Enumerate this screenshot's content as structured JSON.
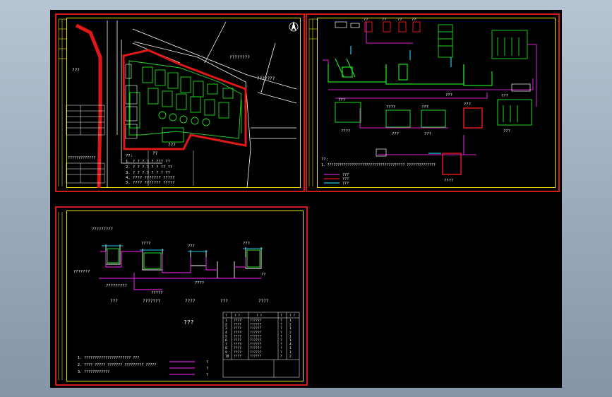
{
  "sheets": [
    {
      "id": "site-plan",
      "title": "???",
      "labels": {
        "boundary_top": "????????",
        "boundary_right": "???????",
        "building_left": "???",
        "entrance": "???",
        "gate": "??"
      },
      "notes": [
        "??:",
        "1. ? ? ? ? ? ???  ??",
        "2. ? ? ? ? ? ? ?? ??",
        "3. ? ? ? ? ? ? ? ??",
        "4. ???? ??????? ?????",
        "5. ???? ??????? ?????",
        "6. ????? ??????? ?????"
      ],
      "legend_title": "?????????????"
    },
    {
      "id": "process-flow",
      "title": "???",
      "tags": [
        "??",
        "??",
        "??",
        "??",
        "???",
        "???",
        "????",
        "???",
        "???",
        "???",
        "????",
        "???",
        "???",
        "???",
        "????"
      ],
      "notes": [
        "??:",
        "1. ?????????????????????????????????????? ??????????????"
      ],
      "legend": [
        "???",
        "???",
        "???"
      ]
    },
    {
      "id": "elevation",
      "title": "???",
      "tags": [
        "?????????",
        "????",
        "???",
        "???",
        "???????",
        "?????????",
        "?????",
        "????",
        "??"
      ],
      "captions": [
        "???",
        "???????",
        "????",
        "???",
        "????"
      ],
      "center_title": "???",
      "notes": [
        "1. ?????????????????????? ???",
        "2. ???? ????? ??????? ????????? ?????",
        "3. ????????????"
      ],
      "legend": [
        "?",
        "?",
        "?"
      ],
      "table_header": [
        "?",
        "? ?",
        "? ?",
        "?",
        "? ?"
      ],
      "table_rows": [
        [
          "1",
          "????",
          "??????",
          "?",
          "1"
        ],
        [
          "2",
          "????",
          "??????",
          "?",
          "2"
        ],
        [
          "3",
          "????",
          "??????",
          "?",
          "1"
        ],
        [
          "4",
          "????",
          "??????",
          "?",
          "2"
        ],
        [
          "5",
          "????",
          "??????",
          "?",
          "1"
        ],
        [
          "6",
          "????",
          "??????",
          "?",
          "1"
        ],
        [
          "7",
          "????",
          "??????",
          "?",
          "4"
        ],
        [
          "8",
          "????",
          "??????",
          "?",
          "1"
        ],
        [
          "9",
          "????",
          "??????",
          "?",
          "1"
        ],
        [
          "10",
          "????",
          "??????",
          "?",
          "2"
        ]
      ]
    }
  ],
  "colors": {
    "background": "#000000",
    "sheet_border": "#d21a1a",
    "frame": "#e6e600",
    "primary_line": "#ffffff",
    "pipe_green": "#22dd22",
    "pipe_magenta": "#d020d0",
    "pipe_cyan": "#20c8e8",
    "road_red": "#e01818"
  }
}
